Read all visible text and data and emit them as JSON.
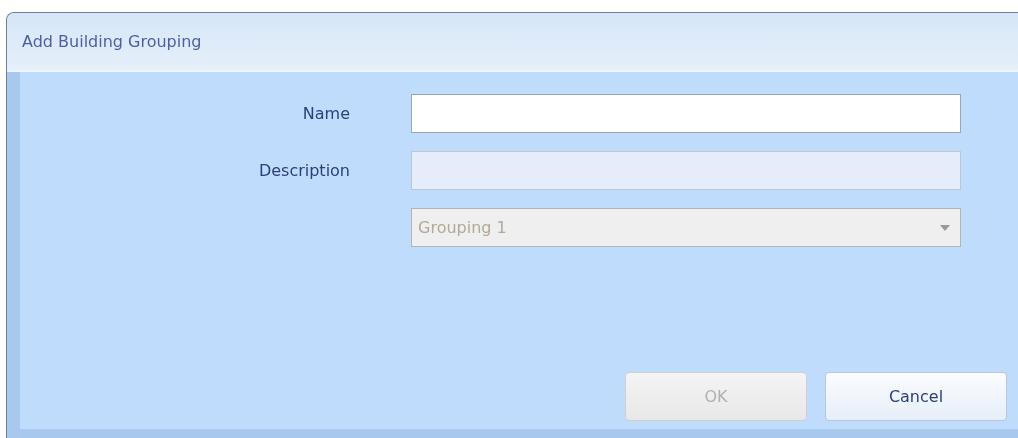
{
  "window": {
    "title": "Add Building Grouping"
  },
  "fields": [
    {
      "kind": "text",
      "label": "Name",
      "disabled": false
    },
    {
      "kind": "text",
      "label": "Description",
      "disabled": true
    },
    {
      "kind": "dropdown",
      "value": "Grouping 1",
      "disabled": true
    }
  ],
  "buttons": [
    {
      "label": "OK",
      "disabled": true
    },
    {
      "label": "Cancel",
      "disabled": false
    }
  ]
}
